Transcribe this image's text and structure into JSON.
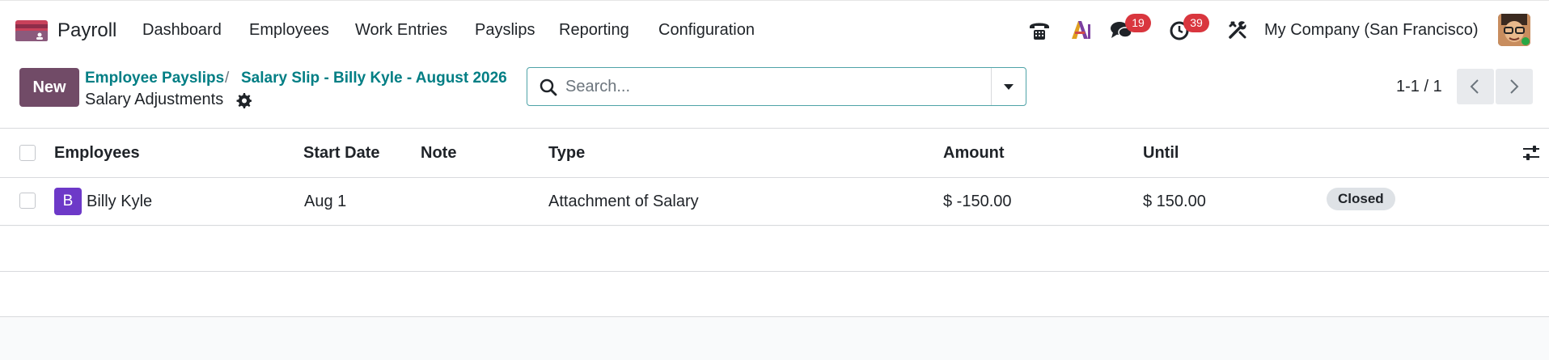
{
  "nav": {
    "app_name": "Payroll",
    "menu": [
      "Dashboard",
      "Employees",
      "Work Entries",
      "Payslips",
      "Reporting",
      "Configuration"
    ],
    "messages_count": "19",
    "activities_count": "39",
    "company": "My Company (San Francisco)",
    "icons": [
      "phone-icon",
      "ai-icon",
      "messages-icon",
      "activities-icon",
      "tools-icon"
    ]
  },
  "control": {
    "new_label": "New",
    "breadcrumb": [
      "Employee Payslips",
      "Salary Slip - Billy Kyle - August 2026"
    ],
    "breadcrumb_sep": "/",
    "current": "Salary Adjustments",
    "search_placeholder": "Search...",
    "pager": "1-1 / 1"
  },
  "table": {
    "columns": [
      "Employees",
      "Start Date",
      "Note",
      "Type",
      "Amount",
      "Until"
    ],
    "rows": [
      {
        "avatar_letter": "B",
        "employee": "Billy Kyle",
        "start_date": "Aug 1",
        "note": "",
        "type": "Attachment of Salary",
        "amount": "$ -150.00",
        "until": "$ 150.00",
        "status": "Closed"
      }
    ]
  },
  "colors": {
    "brand": "#714b67",
    "link": "#017e84",
    "badge": "#d9363e",
    "avatar_bg": "#6d39c8"
  }
}
